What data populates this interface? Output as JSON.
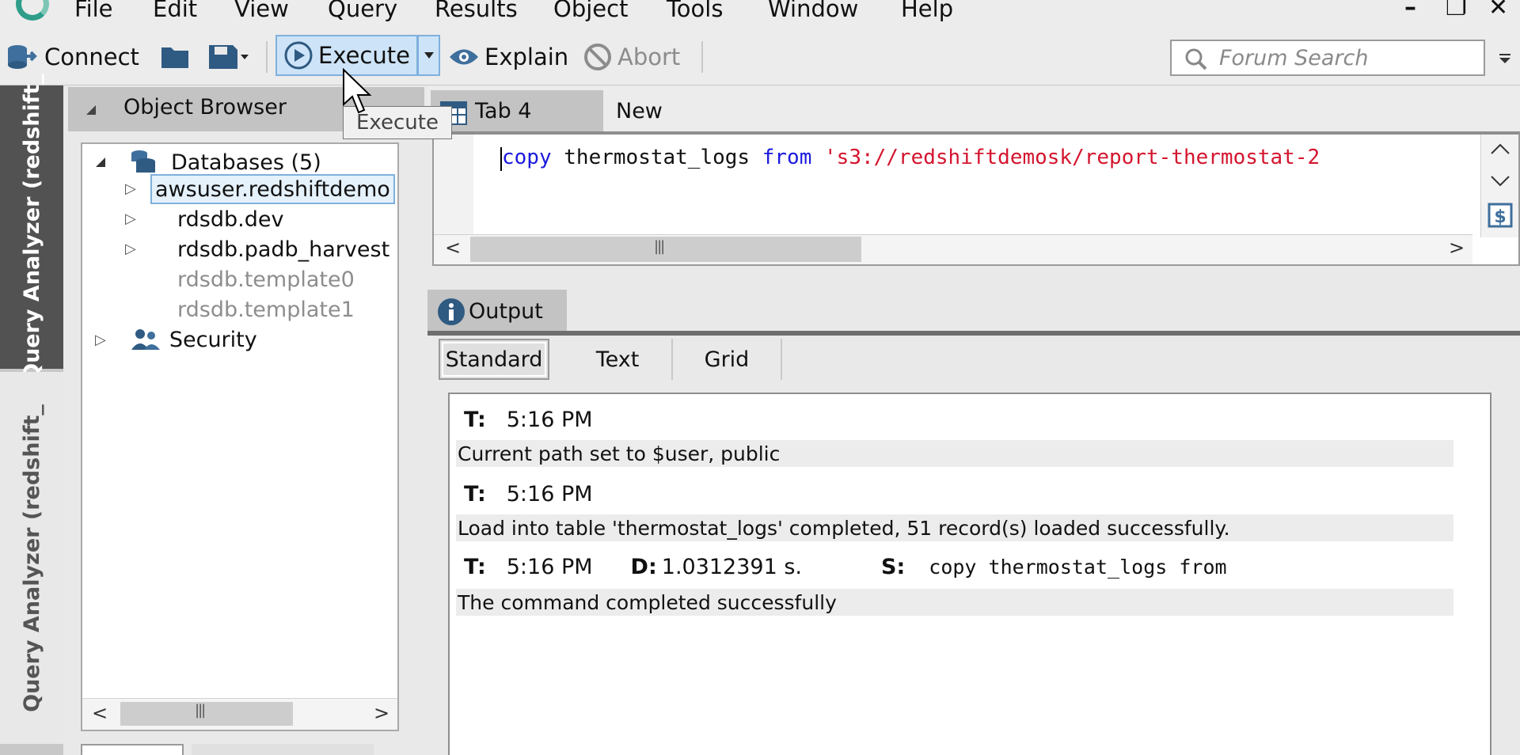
{
  "menubar": {
    "items": [
      "File",
      "Edit",
      "View",
      "Query",
      "Results",
      "Object",
      "Tools",
      "Window",
      "Help"
    ],
    "window_controls": [
      "minimize",
      "restore",
      "close"
    ]
  },
  "toolbar": {
    "connect_label": "Connect",
    "execute_label": "Execute",
    "explain_label": "Explain",
    "abort_label": "Abort",
    "search_placeholder": "Forum Search"
  },
  "tooltip": {
    "text": "Execute"
  },
  "side_tabs": [
    "Query Analyzer (redshift_",
    "Query Analyzer (redshift_"
  ],
  "object_browser": {
    "title": "Object Browser",
    "databases_label": "Databases (5)",
    "databases": [
      {
        "name": "awsuser.redshiftdemo",
        "selected": true,
        "muted": false
      },
      {
        "name": "rdsdb.dev",
        "selected": false,
        "muted": false
      },
      {
        "name": "rdsdb.padb_harvest",
        "selected": false,
        "muted": false
      },
      {
        "name": "rdsdb.template0",
        "selected": false,
        "muted": true
      },
      {
        "name": "rdsdb.template1",
        "selected": false,
        "muted": true
      }
    ],
    "security_label": "Security"
  },
  "editor": {
    "tabs": [
      "Tab 4",
      "New"
    ],
    "sql": {
      "kw1": "copy",
      "ident": " thermostat_logs ",
      "kw2": "from",
      "str": " 's3://redshiftdemosk/report-thermostat-2"
    }
  },
  "output": {
    "title": "Output",
    "subtabs": [
      "Standard",
      "Text",
      "Grid"
    ],
    "t_label": "T:",
    "d_label": "D:",
    "s_label": "S:",
    "entries": [
      {
        "time": "5:16 PM",
        "message": "Current path set to $user, public"
      },
      {
        "time": "5:16 PM",
        "message": "Load into table 'thermostat_logs' completed, 51 record(s) loaded successfully."
      },
      {
        "time": "5:16 PM",
        "duration": "1.0312391 s.",
        "statement": "copy thermostat_logs from",
        "message": "The command completed successfully"
      }
    ]
  },
  "colors": {
    "accent": "#cde3f7",
    "sql_keyword": "#1a1adc",
    "sql_string": "#d4152e",
    "active_side_tab": "#525252"
  }
}
